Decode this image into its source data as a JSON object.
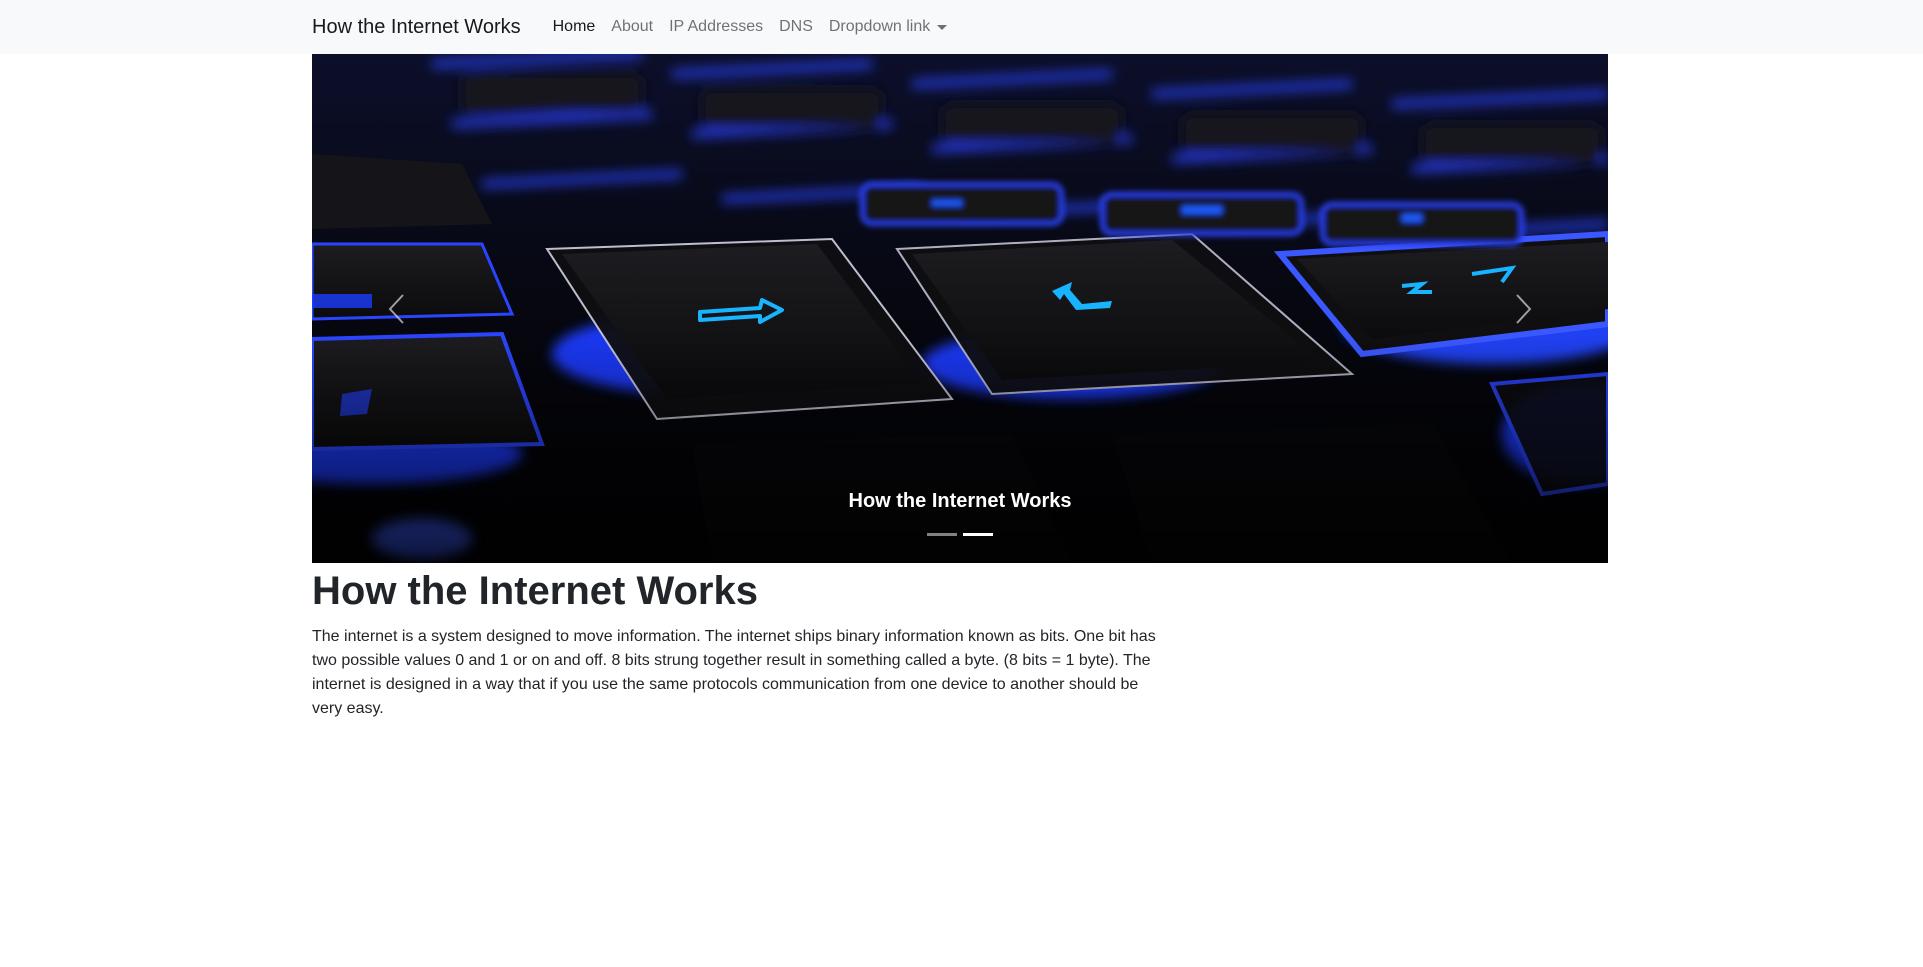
{
  "navbar": {
    "brand": "How the Internet Works",
    "links": [
      {
        "label": "Home"
      },
      {
        "label": "About"
      },
      {
        "label": "IP Addresses"
      },
      {
        "label": "DNS"
      },
      {
        "label": "Dropdown link"
      }
    ]
  },
  "carousel": {
    "caption": "How the Internet Works",
    "prev_icon": "chevron-left-icon",
    "next_icon": "chevron-right-icon",
    "slide_count": 2,
    "active_slide": 2
  },
  "main": {
    "heading": "How the Internet Works",
    "paragraph": "The internet is a system designed to move information. The internet ships binary information known as bits. One bit has two possible values 0 and 1 or on and off. 8 bits strung together result in something called a byte. (8 bits = 1 byte). The internet is designed in a way that if you use the same protocols communication from one device to another should be very easy."
  },
  "colors": {
    "navbar_bg": "#f8f9fa",
    "key_glow": "#1a3cff",
    "key_symbol": "#19b4ff"
  }
}
